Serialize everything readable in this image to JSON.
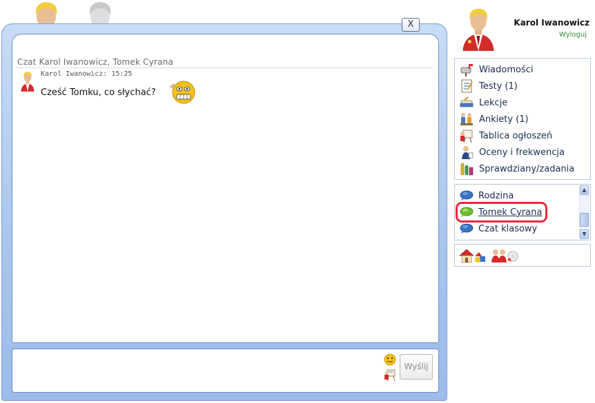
{
  "chat": {
    "close_label": "X",
    "title": "Czat Karol Iwanowicz, Tomek Cyrana",
    "participants": [
      "Karol Iwanowicz",
      "Tomek Cyrana"
    ],
    "messages": [
      {
        "author_time": "Karol Iwanowicz: 15:25",
        "text": "Cześć Tomku, co słychać?",
        "emoticon": "grinning-smiley-icon"
      }
    ],
    "input_value": "",
    "send_label": "Wyślij"
  },
  "user": {
    "name": "Karol Iwanowicz",
    "logout_label": "Wyloguj"
  },
  "menu": {
    "items": [
      {
        "label": "Wiadomości",
        "icon": "mailbox-icon"
      },
      {
        "label": "Testy (1)",
        "icon": "test-sheet-icon"
      },
      {
        "label": "Lekcje",
        "icon": "lesson-books-icon"
      },
      {
        "label": "Ankiety (1)",
        "icon": "survey-people-icon"
      },
      {
        "label": "Tablica ogłoszeń",
        "icon": "notice-board-icon"
      },
      {
        "label": "Oceny i frekwencja",
        "icon": "grades-icon"
      },
      {
        "label": "Sprawdziany/zadania",
        "icon": "lab-flasks-icon"
      }
    ]
  },
  "rooms": {
    "items": [
      {
        "label": "Rodzina",
        "active": false
      },
      {
        "label": "Tomek Cyrana",
        "active": true
      },
      {
        "label": "Czat klasowy",
        "active": false
      }
    ]
  },
  "tools": [
    "home-icon",
    "shapes-icon",
    "people-icon"
  ],
  "colors": {
    "frame_blue": "#a9c5ee",
    "highlight_red": "#e8283f",
    "logout_green": "#2f8c2f"
  }
}
